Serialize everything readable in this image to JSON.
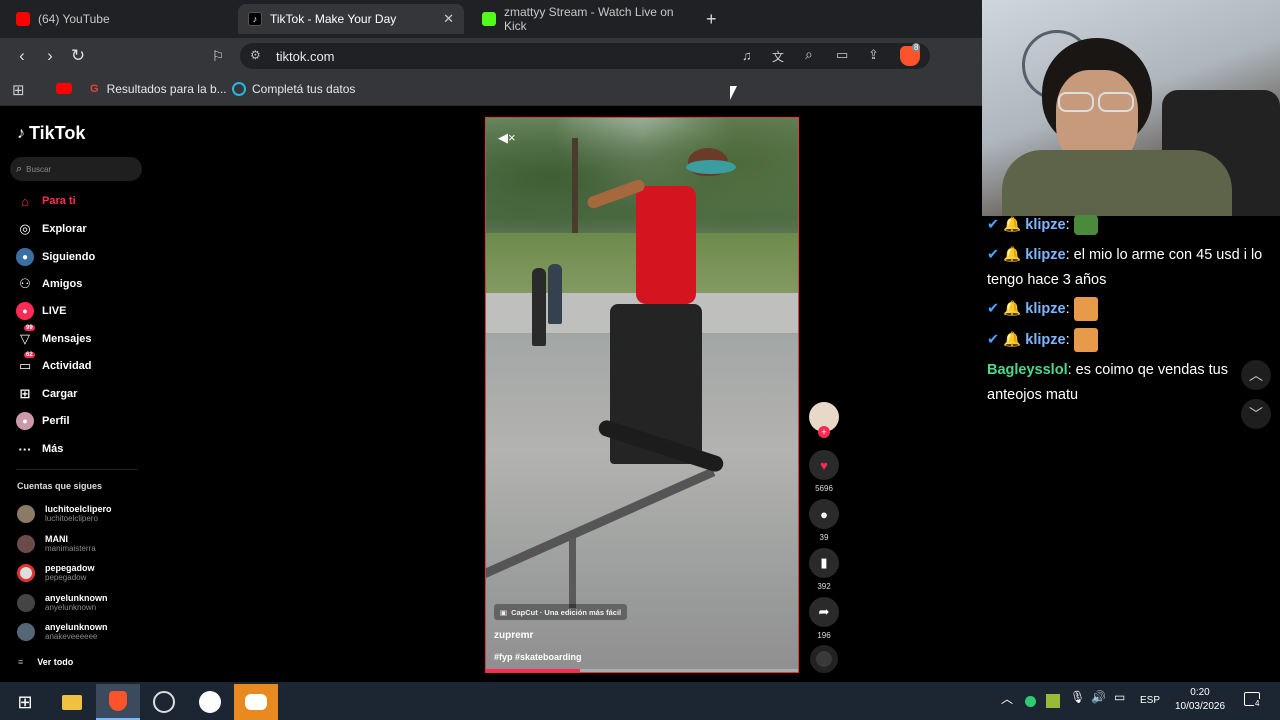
{
  "browser": {
    "tabs": [
      {
        "label": "(64) YouTube",
        "color": "#ff0000"
      },
      {
        "label": "TikTok - Make Your Day",
        "color": "#ffffff"
      },
      {
        "label": "zmattyy Stream - Watch Live on Kick",
        "color": "#53fc18"
      }
    ],
    "url": "tiktok.com",
    "shield_count": "8",
    "bookmarks": [
      "Resultados para la b...",
      "Completá tus datos"
    ]
  },
  "tiktok": {
    "logo": "TikTok",
    "search_placeholder": "Buscar",
    "nav": [
      {
        "label": "Para ti",
        "icon": "home-icon",
        "badge": ""
      },
      {
        "label": "Explorar",
        "icon": "compass-icon",
        "badge": ""
      },
      {
        "label": "Siguiendo",
        "icon": "following-icon",
        "badge": ""
      },
      {
        "label": "Amigos",
        "icon": "friends-icon",
        "badge": ""
      },
      {
        "label": "LIVE",
        "icon": "live-icon",
        "badge": ""
      },
      {
        "label": "Mensajes",
        "icon": "messages-icon",
        "badge": "99"
      },
      {
        "label": "Actividad",
        "icon": "activity-icon",
        "badge": "62"
      },
      {
        "label": "Cargar",
        "icon": "upload-icon",
        "badge": ""
      },
      {
        "label": "Perfil",
        "icon": "profile-icon",
        "badge": ""
      },
      {
        "label": "Más",
        "icon": "more-icon",
        "badge": ""
      }
    ],
    "following_title": "Cuentas que sigues",
    "following": [
      {
        "name": "luchitoelclipero",
        "handle": "luchitoelclipero"
      },
      {
        "name": "MANI",
        "handle": "manimaisterra"
      },
      {
        "name": "pepegadow",
        "handle": "pepegadow"
      },
      {
        "name": "anyelunknown",
        "handle": "anyelunknown"
      },
      {
        "name": "anyelunknown",
        "handle": "anakeveeeeee"
      }
    ],
    "see_all": "Ver todo",
    "video": {
      "capcut": "CapCut · Una edición más fácil",
      "author": "zupremr",
      "tags": "#fyp #skateboarding",
      "progress": 0.3
    },
    "actions": {
      "likes": "5696",
      "comments": "39",
      "saves": "392",
      "shares": "196"
    }
  },
  "chat": {
    "messages": [
      {
        "user": "klipze",
        "color": "#7fb6ff",
        "text": "",
        "emote": true
      },
      {
        "user": "klipze",
        "color": "#7fb6ff",
        "text": "el mio lo arme con 45 usd i lo tengo hace 3 años",
        "emote": false
      },
      {
        "user": "klipze",
        "color": "#7fb6ff",
        "text": "",
        "emote": true
      },
      {
        "user": "klipze",
        "color": "#7fb6ff",
        "text": "",
        "emote": true
      },
      {
        "user": "Bagleysslol",
        "color": "#4cd98a",
        "text": "es coimo qe vendas tus anteojos matu",
        "emote": false
      }
    ]
  },
  "taskbar": {
    "language": "ESP",
    "time": "0:20",
    "date": "10/03/2026",
    "notifications": "4"
  }
}
